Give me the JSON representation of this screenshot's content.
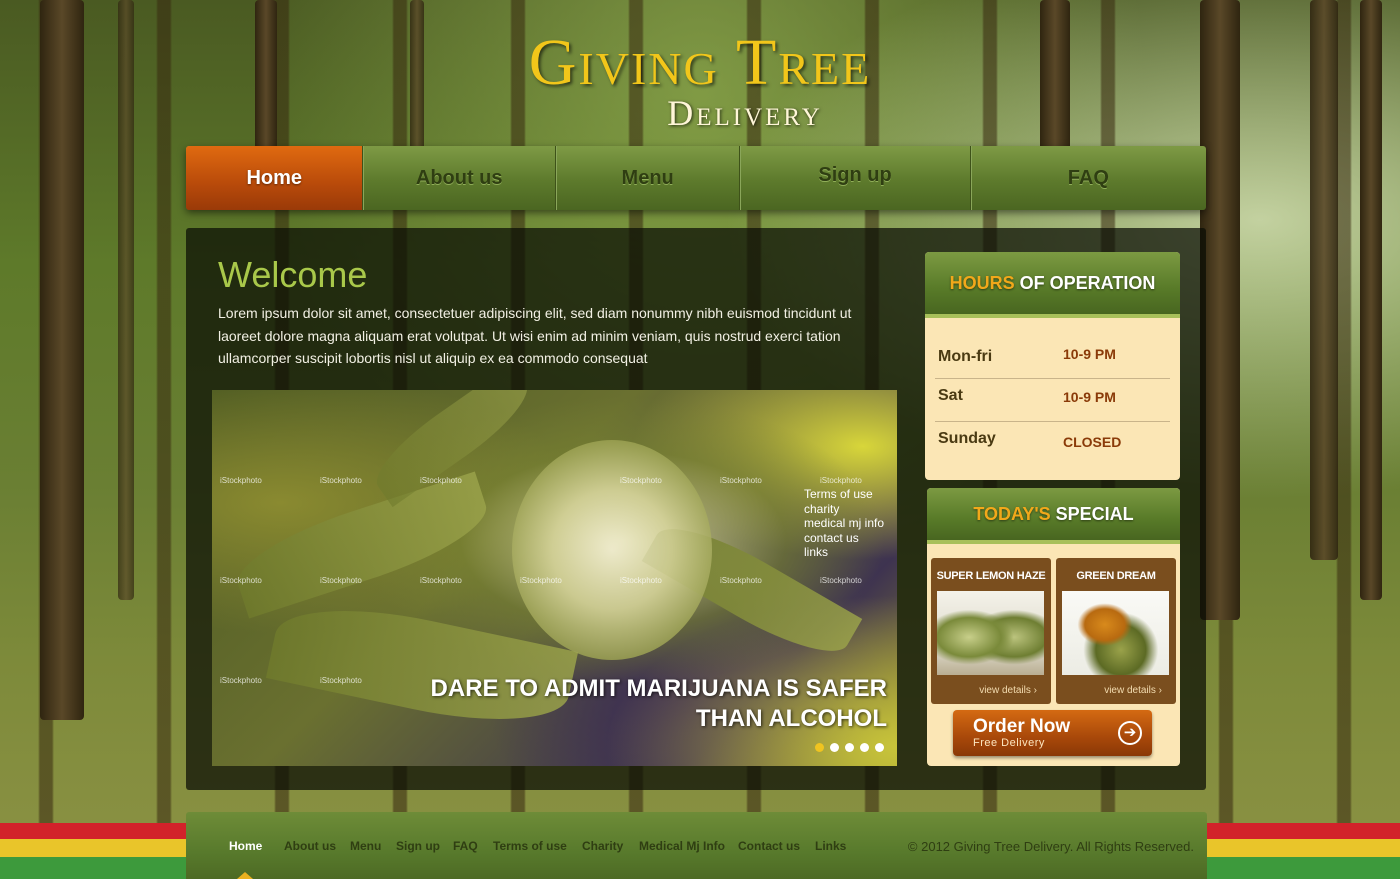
{
  "logo": {
    "line1": "Giving Tree",
    "line2": "Delivery"
  },
  "nav": {
    "items": [
      {
        "label": "Home",
        "active": true
      },
      {
        "label": "About us"
      },
      {
        "label": "Menu"
      },
      {
        "label": "Sign up"
      },
      {
        "label": "FAQ"
      }
    ]
  },
  "welcome": {
    "title": "Welcome",
    "text": "Lorem ipsum dolor sit amet, consectetuer adipiscing elit, sed diam nonummy nibh euismod tincidunt ut laoreet dolore magna aliquam erat volutpat. Ut wisi enim ad minim veniam, quis nostrud exerci tation ullamcorper suscipit lobortis nisl ut aliquip ex ea commodo consequat"
  },
  "slider": {
    "watermark": "iStockphoto",
    "links": [
      "Terms of use",
      "charity",
      "medical mj info",
      "contact us",
      "links"
    ],
    "caption_line1": "DARE TO ADMIT MARIJUANA IS SAFER",
    "caption_line2": "THAN ALCOHOL",
    "slide_count": 5,
    "active_slide": 1
  },
  "hours": {
    "title_highlight": "HOURS",
    "title_rest": "OF OPERATION",
    "rows": [
      {
        "day": "Mon-fri",
        "time": "10-9 PM"
      },
      {
        "day": "Sat",
        "time": "10-9 PM"
      },
      {
        "day": "Sunday",
        "time": "CLOSED"
      }
    ]
  },
  "special": {
    "title_highlight": "TODAY'S",
    "title_rest": "SPECIAL",
    "items": [
      {
        "name": "SUPER LEMON HAZE",
        "link": "view details"
      },
      {
        "name": "GREEN DREAM",
        "link": "view details"
      }
    ],
    "order_title": "Order Now",
    "order_sub": "Free Delivery"
  },
  "footer": {
    "links": [
      "Home",
      "About us",
      "Menu",
      "Sign up",
      "FAQ",
      "Terms of use",
      "Charity",
      "Medical Mj Info",
      "Contact us",
      "Links"
    ],
    "copyright": "© 2012 Giving  Tree Delivery. All Rights Reserved."
  },
  "colors": {
    "accent": "#f2c61a",
    "nav_active": "#c85a0c",
    "panel_bg": "#fbe6b5",
    "green": "#5d7a2c"
  }
}
